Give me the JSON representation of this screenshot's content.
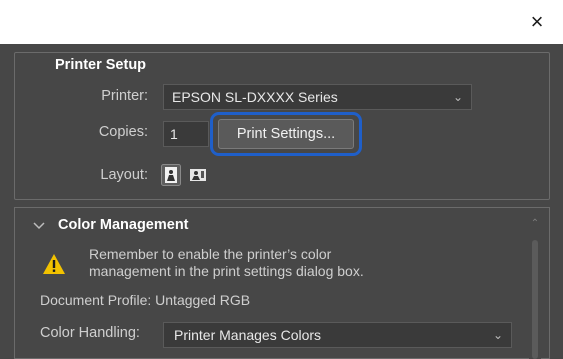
{
  "window": {
    "close_glyph": "×"
  },
  "printer_setup": {
    "title": "Printer Setup",
    "printer_label": "Printer:",
    "printer_value": "EPSON SL-DXXXX Series",
    "copies_label": "Copies:",
    "copies_value": "1",
    "print_settings_button": "Print Settings...",
    "layout_label": "Layout:",
    "layout_options": [
      "portrait",
      "landscape"
    ]
  },
  "color_management": {
    "title": "Color Management",
    "warning_line1": "Remember to enable the printer’s color",
    "warning_line2": "management in the print settings dialog box.",
    "document_profile": "Document Profile: Untagged RGB",
    "color_handling_label": "Color Handling:",
    "color_handling_value": "Printer Manages Colors"
  },
  "colors": {
    "panel": "#474747",
    "highlight": "#1f5fc9",
    "warning": "#f2c200"
  }
}
